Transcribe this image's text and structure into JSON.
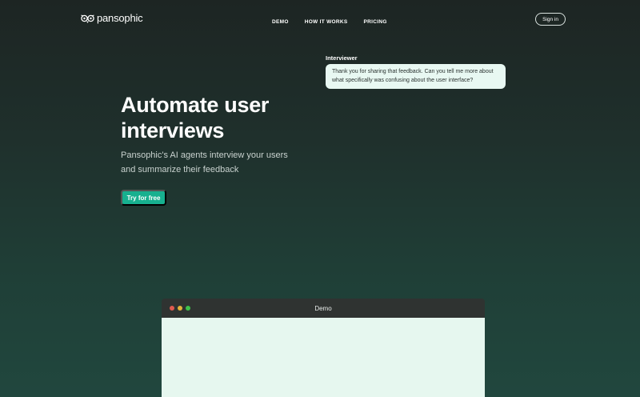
{
  "header": {
    "logo_text": "pansophic",
    "nav": [
      {
        "label": "DEMO"
      },
      {
        "label": "HOW IT WORKS"
      },
      {
        "label": "PRICING"
      }
    ],
    "signin_label": "Sign in"
  },
  "hero": {
    "title": "Automate user interviews",
    "subtitle": "Pansophic's AI agents interview your users and summarize their feedback",
    "cta_label": "Try for free"
  },
  "chat": {
    "speaker": "Interviewer",
    "message": "Thank you for sharing that feedback. Can you tell me more about what specifically was confusing about the user interface?"
  },
  "demo": {
    "title": "Demo",
    "window_controls": [
      {
        "name": "close",
        "color": "#e05a4f"
      },
      {
        "name": "minimize",
        "color": "#e2b13a"
      },
      {
        "name": "maximize",
        "color": "#3ec14b"
      }
    ]
  },
  "colors": {
    "accent": "#17b08f",
    "bubble_bg": "#e8f8f2",
    "demo_bg": "#e6f7ef"
  }
}
